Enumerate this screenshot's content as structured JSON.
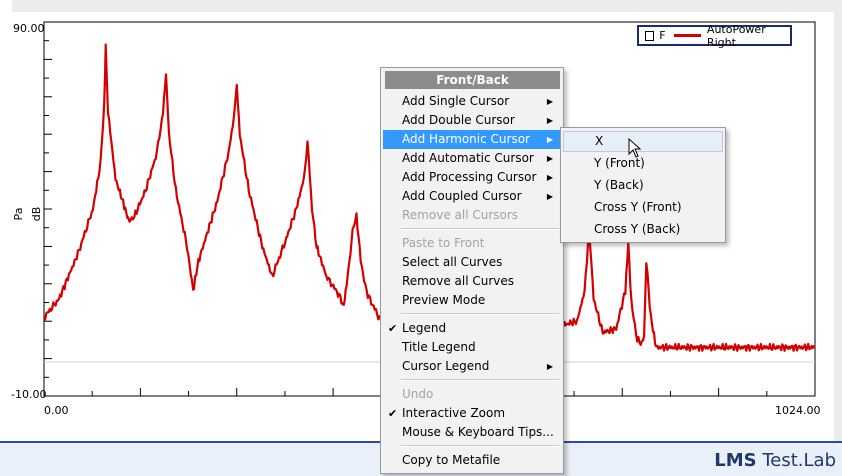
{
  "chart_data": {
    "type": "line",
    "title": "",
    "xlabel": "",
    "ylabel": [
      "Pa",
      "dB"
    ],
    "xlim": [
      0,
      1024
    ],
    "ylim": [
      -10,
      90
    ],
    "x_tick_labels": [
      "0.00",
      "1024.00"
    ],
    "y_tick_labels": [
      "90.00",
      "-10.00"
    ],
    "grid": false,
    "legend_position": "top-right",
    "series": [
      {
        "name": "AutoPower Right",
        "color": "#d40000",
        "points": [
          [
            0,
            11
          ],
          [
            20,
            16
          ],
          [
            45,
            28
          ],
          [
            65,
            40
          ],
          [
            75,
            52
          ],
          [
            80,
            68
          ],
          [
            82,
            83
          ],
          [
            85,
            66
          ],
          [
            95,
            48
          ],
          [
            108,
            40
          ],
          [
            112,
            37
          ],
          [
            120,
            38
          ],
          [
            135,
            45
          ],
          [
            150,
            55
          ],
          [
            158,
            66
          ],
          [
            162,
            76
          ],
          [
            166,
            60
          ],
          [
            175,
            45
          ],
          [
            190,
            30
          ],
          [
            198,
            18
          ],
          [
            205,
            26
          ],
          [
            230,
            42
          ],
          [
            245,
            55
          ],
          [
            252,
            64
          ],
          [
            256,
            73
          ],
          [
            260,
            60
          ],
          [
            272,
            45
          ],
          [
            290,
            30
          ],
          [
            303,
            22
          ],
          [
            320,
            31
          ],
          [
            335,
            40
          ],
          [
            345,
            48
          ],
          [
            350,
            58
          ],
          [
            356,
            40
          ],
          [
            362,
            30
          ],
          [
            375,
            22
          ],
          [
            392,
            17
          ],
          [
            398,
            14
          ],
          [
            402,
            20
          ],
          [
            410,
            34
          ],
          [
            415,
            38
          ],
          [
            422,
            24
          ],
          [
            430,
            17
          ],
          [
            450,
            9
          ],
          [
            468,
            16
          ],
          [
            480,
            28
          ],
          [
            500,
            38
          ],
          [
            510,
            48
          ],
          [
            514,
            55
          ],
          [
            518,
            45
          ],
          [
            528,
            33
          ],
          [
            548,
            19
          ],
          [
            563,
            13
          ],
          [
            570,
            9
          ],
          [
            580,
            12
          ],
          [
            590,
            18
          ],
          [
            600,
            30
          ],
          [
            605,
            45
          ],
          [
            610,
            26
          ],
          [
            625,
            16
          ],
          [
            640,
            10
          ],
          [
            650,
            12
          ],
          [
            664,
            20
          ],
          [
            670,
            35
          ],
          [
            676,
            18
          ],
          [
            690,
            9
          ],
          [
            708,
            10
          ],
          [
            718,
            18
          ],
          [
            724,
            35
          ],
          [
            730,
            16
          ],
          [
            742,
            7
          ],
          [
            760,
            8
          ],
          [
            772,
            18
          ],
          [
            776,
            31
          ],
          [
            780,
            15
          ],
          [
            788,
            5
          ],
          [
            794,
            4
          ],
          [
            797,
            6
          ],
          [
            800,
            26
          ],
          [
            806,
            11
          ],
          [
            813,
            3
          ],
          [
            816,
            3
          ],
          [
            1024,
            3
          ]
        ]
      }
    ]
  },
  "legend": {
    "checkbox_label": "F",
    "series_label": "AutoPower Right"
  },
  "branding": {
    "brand_bold": "LMS",
    "brand_rest": " Test.Lab"
  },
  "context_menu": {
    "header": "Front/Back",
    "items": [
      {
        "label": "Add Single Cursor",
        "submenu": true,
        "enabled": true,
        "checked": false
      },
      {
        "label": "Add Double Cursor",
        "submenu": true,
        "enabled": true,
        "checked": false
      },
      {
        "label": "Add Harmonic Cursor",
        "submenu": true,
        "enabled": true,
        "checked": false,
        "highlighted": true
      },
      {
        "label": "Add Automatic Cursor",
        "submenu": true,
        "enabled": true,
        "checked": false
      },
      {
        "label": "Add Processing Cursor",
        "submenu": true,
        "enabled": true,
        "checked": false
      },
      {
        "label": "Add Coupled Cursor",
        "submenu": true,
        "enabled": true,
        "checked": false
      },
      {
        "label": "Remove all Cursors",
        "submenu": false,
        "enabled": false,
        "checked": false
      },
      {
        "label": "Paste to Front",
        "submenu": false,
        "enabled": false,
        "checked": false
      },
      {
        "label": "Select all Curves",
        "submenu": false,
        "enabled": true,
        "checked": false
      },
      {
        "label": "Remove all Curves",
        "submenu": false,
        "enabled": true,
        "checked": false
      },
      {
        "label": "Preview Mode",
        "submenu": false,
        "enabled": true,
        "checked": false
      },
      {
        "label": "Legend",
        "submenu": false,
        "enabled": true,
        "checked": true
      },
      {
        "label": "Title Legend",
        "submenu": false,
        "enabled": true,
        "checked": false
      },
      {
        "label": "Cursor Legend",
        "submenu": true,
        "enabled": true,
        "checked": false
      },
      {
        "label": "Undo",
        "submenu": false,
        "enabled": false,
        "checked": false
      },
      {
        "label": "Interactive Zoom",
        "submenu": false,
        "enabled": true,
        "checked": true
      },
      {
        "label": "Mouse & Keyboard Tips...",
        "submenu": false,
        "enabled": true,
        "checked": false
      },
      {
        "label": "Copy to Metafile",
        "submenu": false,
        "enabled": true,
        "checked": false
      }
    ]
  },
  "harmonic_submenu": {
    "items": [
      "X",
      "Y (Front)",
      "Y (Back)",
      "Cross Y (Front)",
      "Cross Y (Back)"
    ]
  }
}
